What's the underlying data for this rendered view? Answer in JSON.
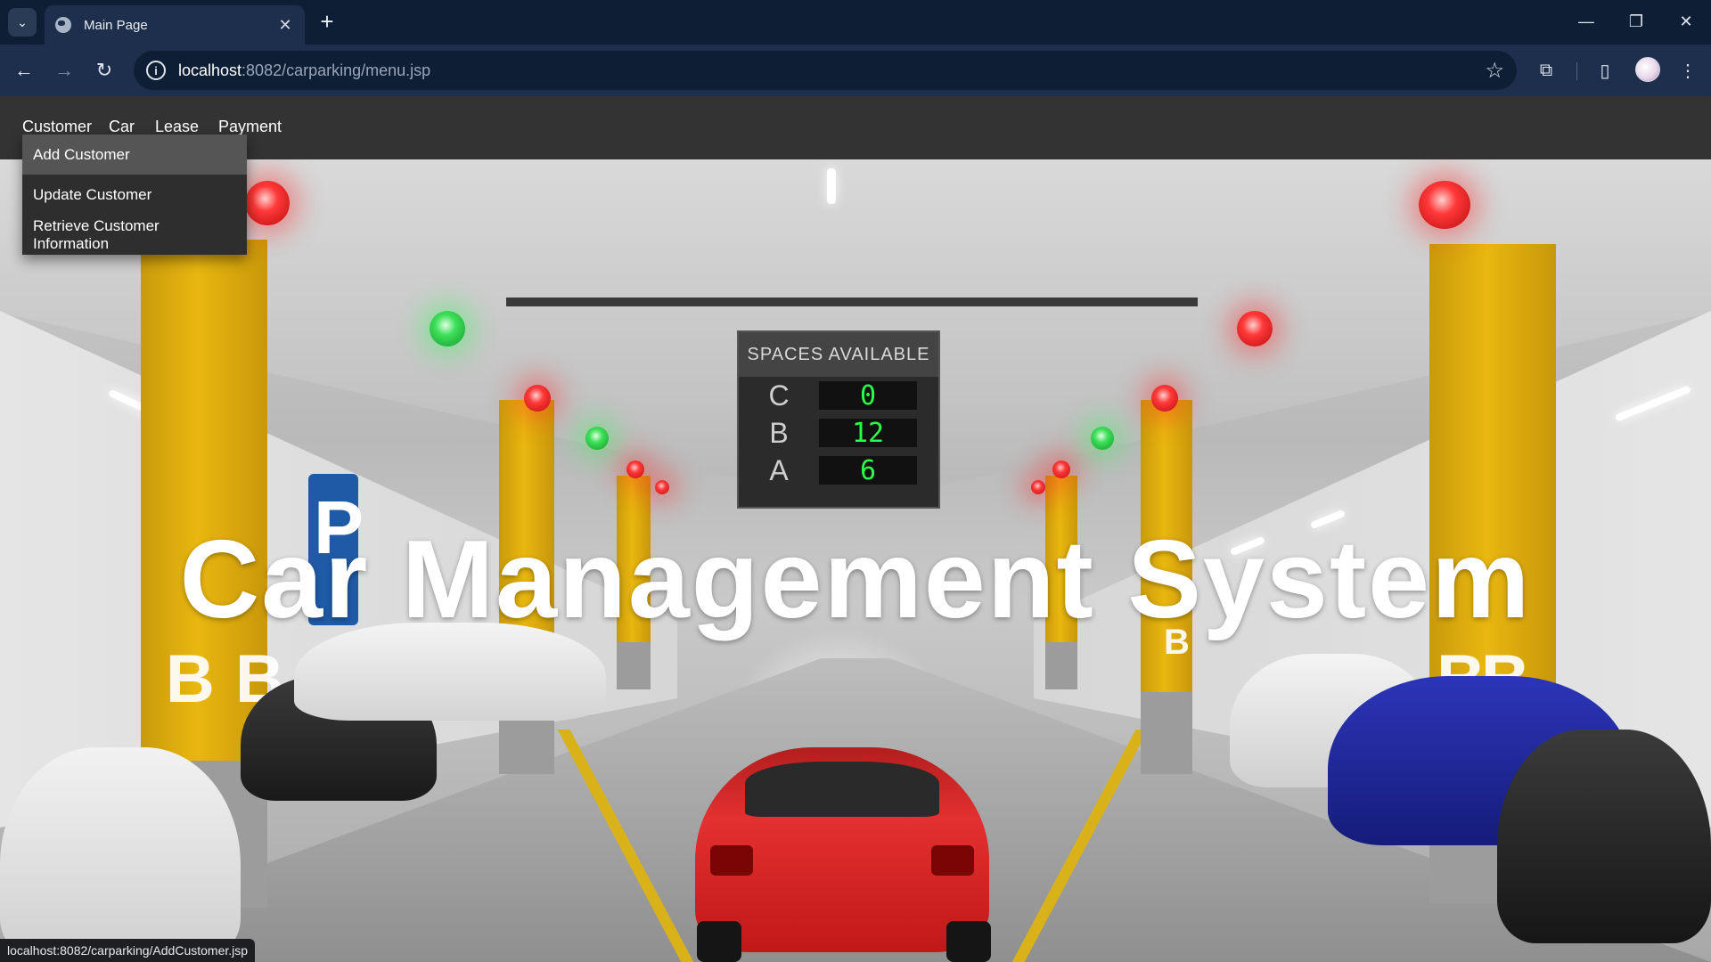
{
  "browser": {
    "tab_title": "Main Page",
    "tab_close": "✕",
    "new_tab": "+",
    "url_host": "localhost",
    "url_path": ":8082/carparking/menu.jsp",
    "status_url": "localhost:8082/carparking/AddCustomer.jsp"
  },
  "menubar": {
    "items": [
      "Customer",
      "Car",
      "Lease",
      "Payment"
    ]
  },
  "dropdown": {
    "items": [
      "Add Customer",
      "Update Customer",
      "Retrieve Customer Information"
    ],
    "hovered_index": 0
  },
  "hero": {
    "title": "Car Management System",
    "sign": {
      "heading": "SPACES  AVAILABLE",
      "rows": [
        {
          "level": "C",
          "count": "0"
        },
        {
          "level": "B",
          "count": "12"
        },
        {
          "level": "A",
          "count": "6"
        }
      ]
    },
    "pillar_letter": "B",
    "parking_sign": "P"
  },
  "colors": {
    "tabbar": "#0e1e35",
    "toolbar": "#1d2f4c",
    "menubar": "#333333",
    "dropdown_bg": "#2e2e2e",
    "dropdown_hover": "#555555"
  },
  "icons": {
    "tab_search": "chevron-down-icon",
    "favicon": "globe-icon",
    "back": "arrow-left-icon",
    "forward": "arrow-right-icon",
    "reload": "reload-icon",
    "site_info": "info-icon",
    "bookmark": "star-icon",
    "extensions": "puzzle-icon",
    "side_panel": "side-panel-icon",
    "profile": "avatar",
    "menu": "kebab-menu-icon"
  }
}
